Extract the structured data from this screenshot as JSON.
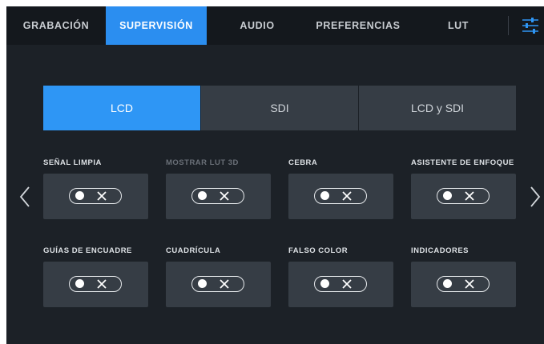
{
  "tabs": [
    {
      "label": "GRABACIÓN",
      "active": false
    },
    {
      "label": "SUPERVISIÓN",
      "active": true
    },
    {
      "label": "AUDIO",
      "active": false
    },
    {
      "label": "PREFERENCIAS",
      "active": false
    },
    {
      "label": "LUT",
      "active": false
    }
  ],
  "output_selector": {
    "options": [
      "LCD",
      "SDI",
      "LCD y SDI"
    ],
    "selected": "LCD"
  },
  "toggles": [
    {
      "label": "SEÑAL LIMPIA",
      "state": "off",
      "enabled": true
    },
    {
      "label": "MOSTRAR LUT 3D",
      "state": "off",
      "enabled": false
    },
    {
      "label": "CEBRA",
      "state": "off",
      "enabled": true
    },
    {
      "label": "ASISTENTE DE ENFOQUE",
      "state": "off",
      "enabled": true
    },
    {
      "label": "GUÍAS DE ENCUADRE",
      "state": "off",
      "enabled": true
    },
    {
      "label": "CUADRÍCULA",
      "state": "off",
      "enabled": true
    },
    {
      "label": "FALSO COLOR",
      "state": "off",
      "enabled": true
    },
    {
      "label": "INDICADORES",
      "state": "off",
      "enabled": true
    }
  ],
  "icons": {
    "settings": "sliders-icon",
    "prev": "chevron-left-icon",
    "next": "chevron-right-icon",
    "toggle_off": "x-icon"
  },
  "colors": {
    "accent": "#2b8ef0",
    "background": "#1c2127",
    "tabbar": "#14181d",
    "card": "#363d45"
  }
}
